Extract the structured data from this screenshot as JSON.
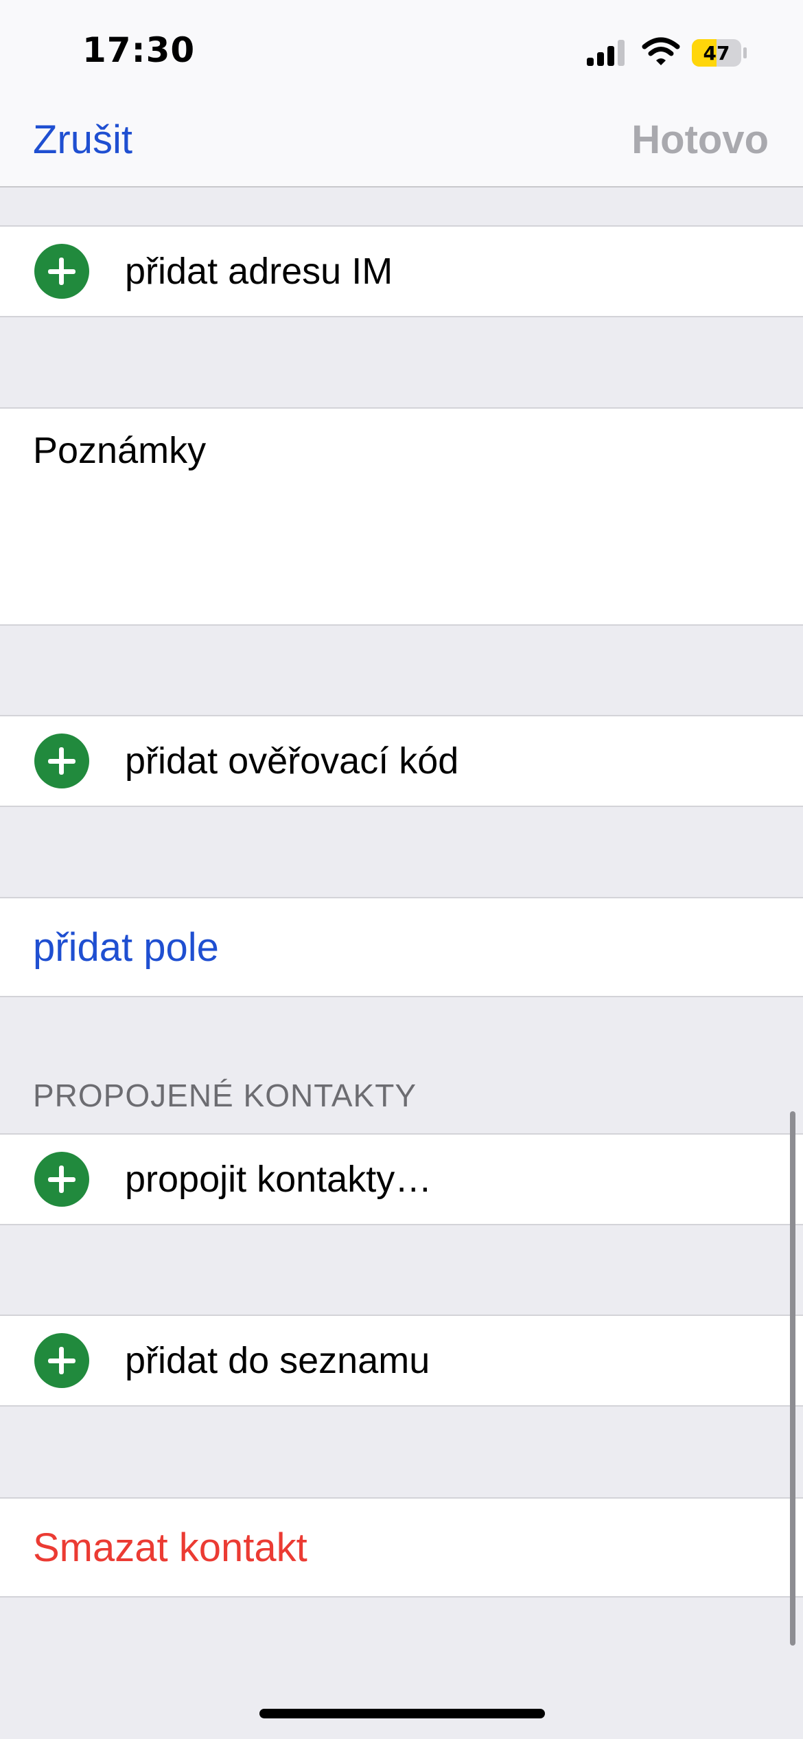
{
  "status_bar": {
    "time": "17:30",
    "battery_level": "47",
    "battery_color": "#FFD60A"
  },
  "nav": {
    "cancel_label": "Zrušit",
    "done_label": "Hotovo"
  },
  "rows": {
    "add_im": "přidat adresu IM",
    "notes": "Poznámky",
    "add_verification_code": "přidat ověřovací kód",
    "add_field": "přidat pole",
    "linked_contacts_header": "PROPOJENÉ KONTAKTY",
    "link_contacts": "propojit kontakty…",
    "add_to_list": "přidat do seznamu",
    "delete_contact": "Smazat kontakt"
  },
  "colors": {
    "accent_blue": "#1F4FD1",
    "add_green": "#218A3D",
    "destructive_red": "#EB3B33",
    "disabled_gray": "#A9A9AE"
  },
  "icons": [
    "cellular-signal-icon",
    "wifi-icon",
    "battery-icon",
    "add-circle-icon"
  ]
}
